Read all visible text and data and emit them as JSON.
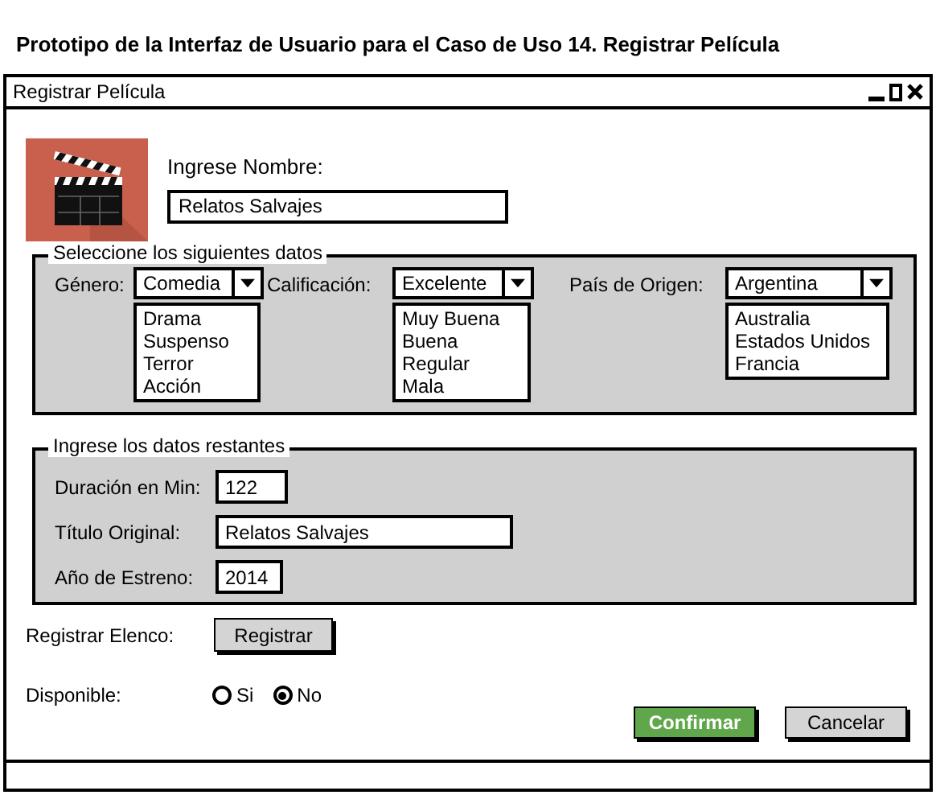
{
  "heading": "Prototipo de la Interfaz de Usuario para el Caso de Uso 14. Registrar Película",
  "window": {
    "title": "Registrar Película"
  },
  "name_field": {
    "label": "Ingrese Nombre:",
    "value": "Relatos Salvajes"
  },
  "selection_group": {
    "legend": "Seleccione los siguientes datos",
    "dropdowns": [
      {
        "label": "Género:",
        "value": "Comedia",
        "options": [
          "Drama",
          "Suspenso",
          "Terror",
          "Acción"
        ]
      },
      {
        "label": "Calificación:",
        "value": "Excelente",
        "options": [
          "Muy Buena",
          "Buena",
          "Regular",
          "Mala"
        ]
      },
      {
        "label": "País de Origen:",
        "value": "Argentina",
        "options": [
          "Australia",
          "Estados Unidos",
          "Francia"
        ]
      }
    ]
  },
  "remaining_group": {
    "legend": "Ingrese los datos restantes",
    "fields": [
      {
        "label": "Duración en Min:",
        "value": "122"
      },
      {
        "label": "Título Original:",
        "value": "Relatos Salvajes"
      },
      {
        "label": "Año de Estreno:",
        "value": "2014"
      }
    ]
  },
  "cast": {
    "label": "Registrar Elenco:",
    "button": "Registrar"
  },
  "available": {
    "label": "Disponible:",
    "options": [
      {
        "label": "Si",
        "selected": false
      },
      {
        "label": "No",
        "selected": true
      }
    ]
  },
  "buttons": [
    {
      "label": "Confirmar",
      "kind": "primary"
    },
    {
      "label": "Cancelar",
      "kind": "secondary"
    }
  ]
}
